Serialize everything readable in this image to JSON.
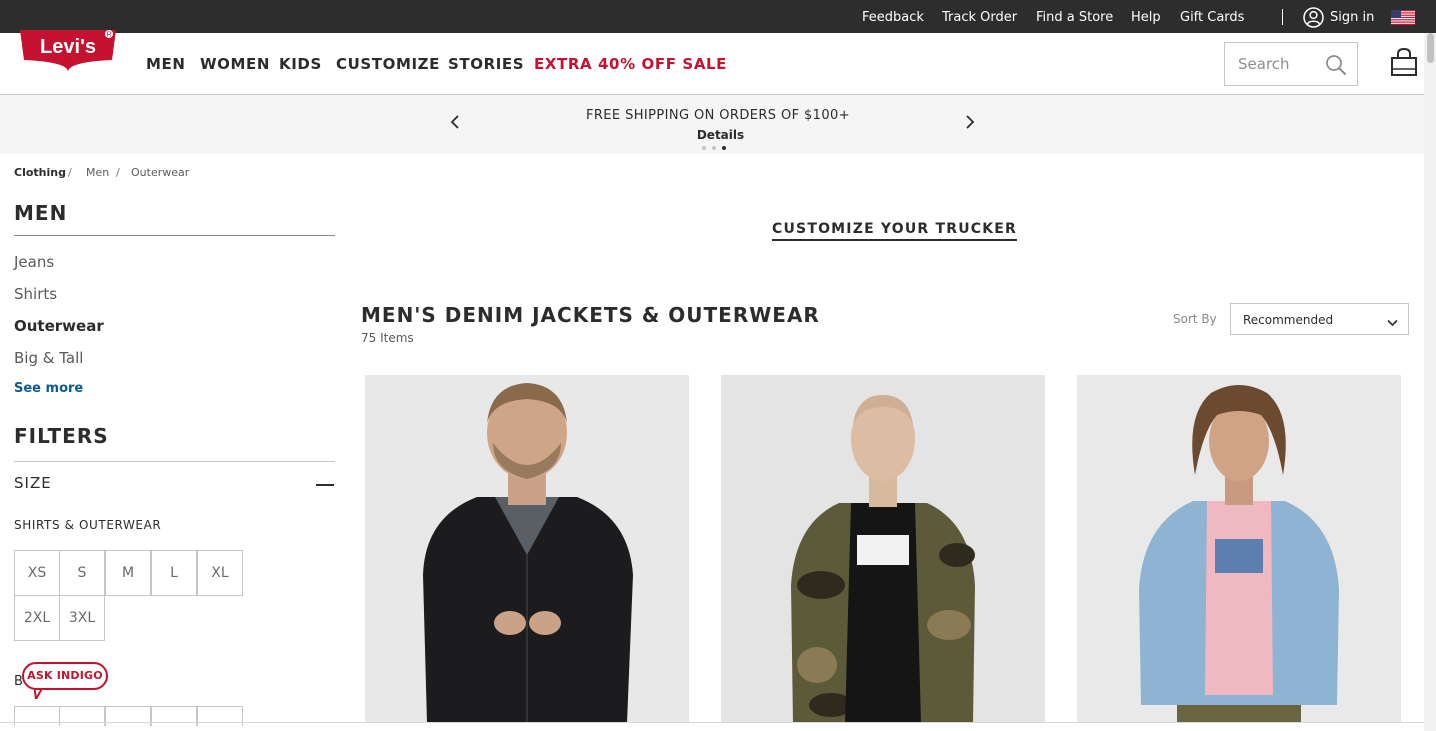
{
  "utility_bar": {
    "links": [
      "Feedback",
      "Track Order",
      "Find a Store",
      "Help",
      "Gift Cards"
    ],
    "sign_in": "Sign in"
  },
  "header": {
    "logo_text": "Levi's",
    "nav": [
      "MEN",
      "WOMEN",
      "KIDS",
      "CUSTOMIZE",
      "STORIES"
    ],
    "sale": "EXTRA 40% OFF SALE",
    "search_placeholder": "Search"
  },
  "promo": {
    "message": "FREE SHIPPING ON ORDERS OF $100+",
    "details": "Details",
    "slide_count": 3,
    "active_slide": 3
  },
  "breadcrumb": [
    "Clothing",
    "Men",
    "Outerwear"
  ],
  "sidebar": {
    "category_title": "MEN",
    "categories": [
      "Jeans",
      "Shirts",
      "Outerwear",
      "Big & Tall"
    ],
    "active_category": "Outerwear",
    "see_more": "See more",
    "filters_title": "FILTERS",
    "size_label": "SIZE",
    "group_label": "SHIRTS & OUTERWEAR",
    "sizes": [
      "XS",
      "S",
      "M",
      "L",
      "XL",
      "2XL",
      "3XL"
    ],
    "next_group_label_partial": "B"
  },
  "ask_indigo": "ASK INDIGO",
  "main": {
    "customize_link": "CUSTOMIZE YOUR TRUCKER",
    "title": "MEN'S DENIM JACKETS & OUTERWEAR",
    "item_count": "75 Items",
    "sort_label": "Sort By",
    "sort_value": "Recommended"
  },
  "colors": {
    "utility_bg": "#2d2d2d",
    "brand_red": "#c41230",
    "link_blue": "#0a5a94",
    "promo_bg": "#f5f5f5"
  }
}
